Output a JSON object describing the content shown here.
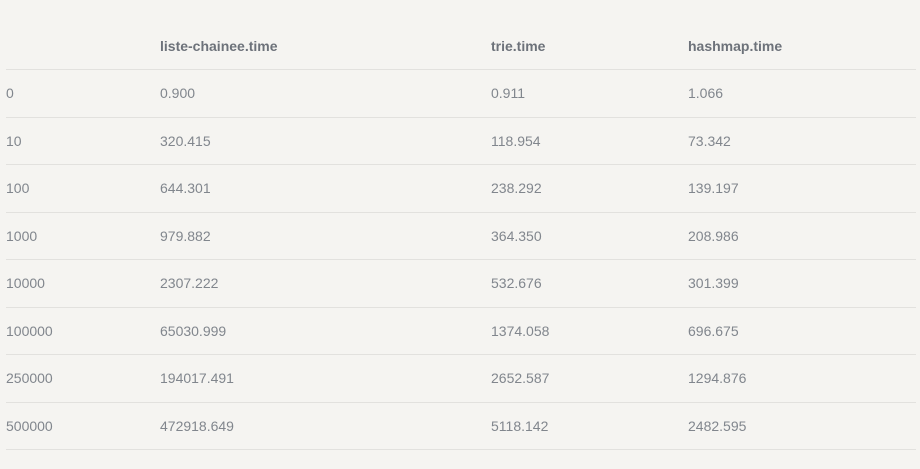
{
  "table": {
    "headers": [
      "",
      "liste-chainee.time",
      "trie.time",
      "hashmap.time"
    ],
    "rows": [
      [
        "0",
        "0.900",
        "0.911",
        "1.066"
      ],
      [
        "10",
        "320.415",
        "118.954",
        "73.342"
      ],
      [
        "100",
        "644.301",
        "238.292",
        "139.197"
      ],
      [
        "1000",
        "979.882",
        "364.350",
        "208.986"
      ],
      [
        "10000",
        "2307.222",
        "532.676",
        "301.399"
      ],
      [
        "100000",
        "65030.999",
        "1374.058",
        "696.675"
      ],
      [
        "250000",
        "194017.491",
        "2652.587",
        "1294.876"
      ],
      [
        "500000",
        "472918.649",
        "5118.142",
        "2482.595"
      ]
    ]
  }
}
